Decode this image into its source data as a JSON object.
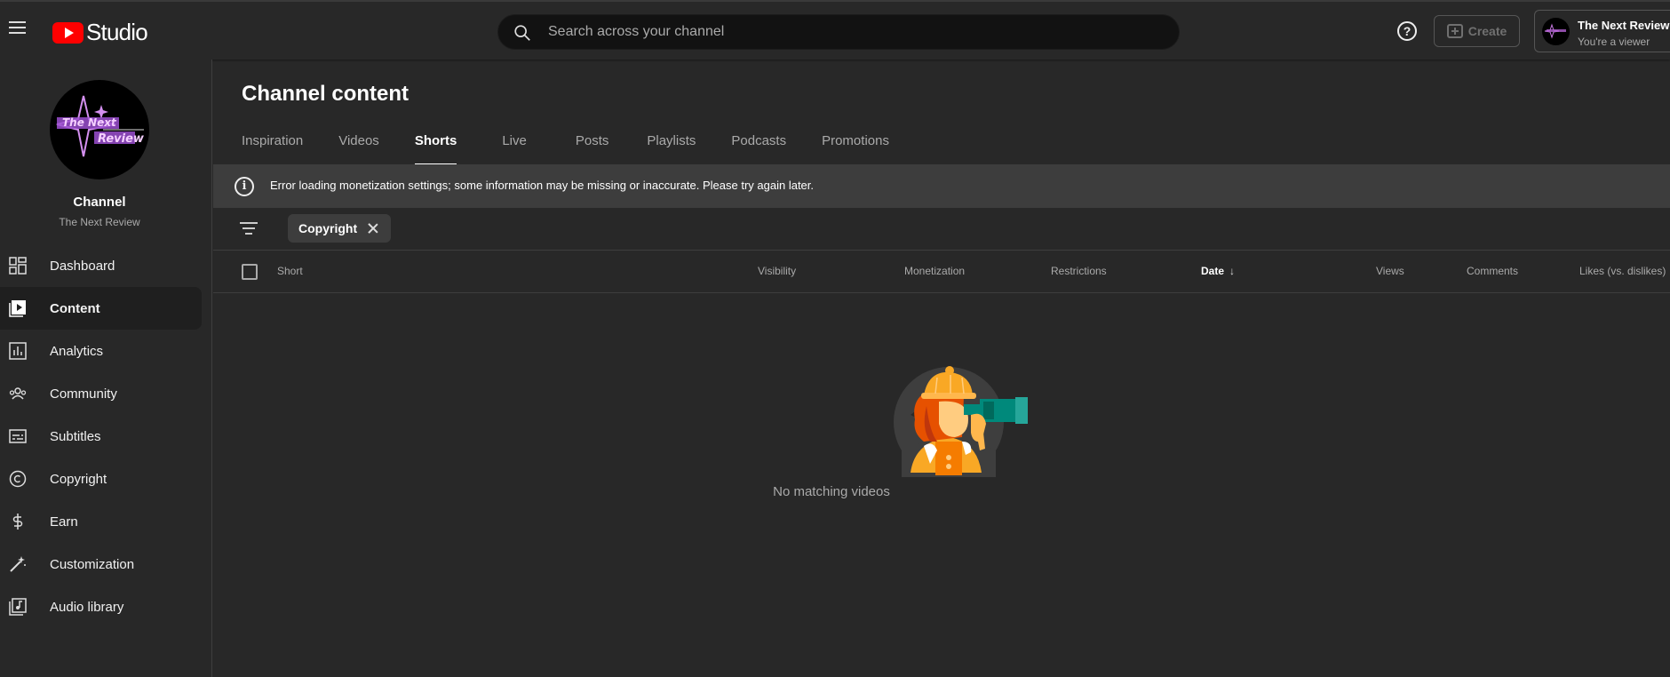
{
  "app": {
    "logo_text": "Studio",
    "brand_color": "#ff0000"
  },
  "search": {
    "placeholder": "Search across your channel"
  },
  "header": {
    "help_icon": "help-icon",
    "create_label": "Create",
    "account_name": "The Next Review",
    "account_role": "You're a viewer"
  },
  "sidebar": {
    "channel_title": "Channel",
    "channel_name": "The Next Review",
    "items": [
      {
        "label": "Dashboard",
        "icon": "dashboard-icon"
      },
      {
        "label": "Content",
        "icon": "content-icon",
        "active": true
      },
      {
        "label": "Analytics",
        "icon": "analytics-icon"
      },
      {
        "label": "Community",
        "icon": "community-icon"
      },
      {
        "label": "Subtitles",
        "icon": "subtitles-icon"
      },
      {
        "label": "Copyright",
        "icon": "copyright-icon"
      },
      {
        "label": "Earn",
        "icon": "earn-icon"
      },
      {
        "label": "Customization",
        "icon": "customization-icon"
      },
      {
        "label": "Audio library",
        "icon": "audio-library-icon"
      }
    ]
  },
  "main": {
    "title": "Channel content",
    "tabs": [
      {
        "label": "Inspiration"
      },
      {
        "label": "Videos"
      },
      {
        "label": "Shorts",
        "active": true
      },
      {
        "label": "Live"
      },
      {
        "label": "Posts"
      },
      {
        "label": "Playlists"
      },
      {
        "label": "Podcasts"
      },
      {
        "label": "Promotions"
      }
    ],
    "banner_text": "Error loading monetization settings; some information may be missing or inaccurate. Please try again later.",
    "filter_chip": "Copyright",
    "columns": [
      "Short",
      "Visibility",
      "Monetization",
      "Restrictions",
      "Date",
      "Views",
      "Comments",
      "Likes (vs. dislikes)"
    ],
    "sorted_column": "Date",
    "empty_text": "No matching videos"
  }
}
